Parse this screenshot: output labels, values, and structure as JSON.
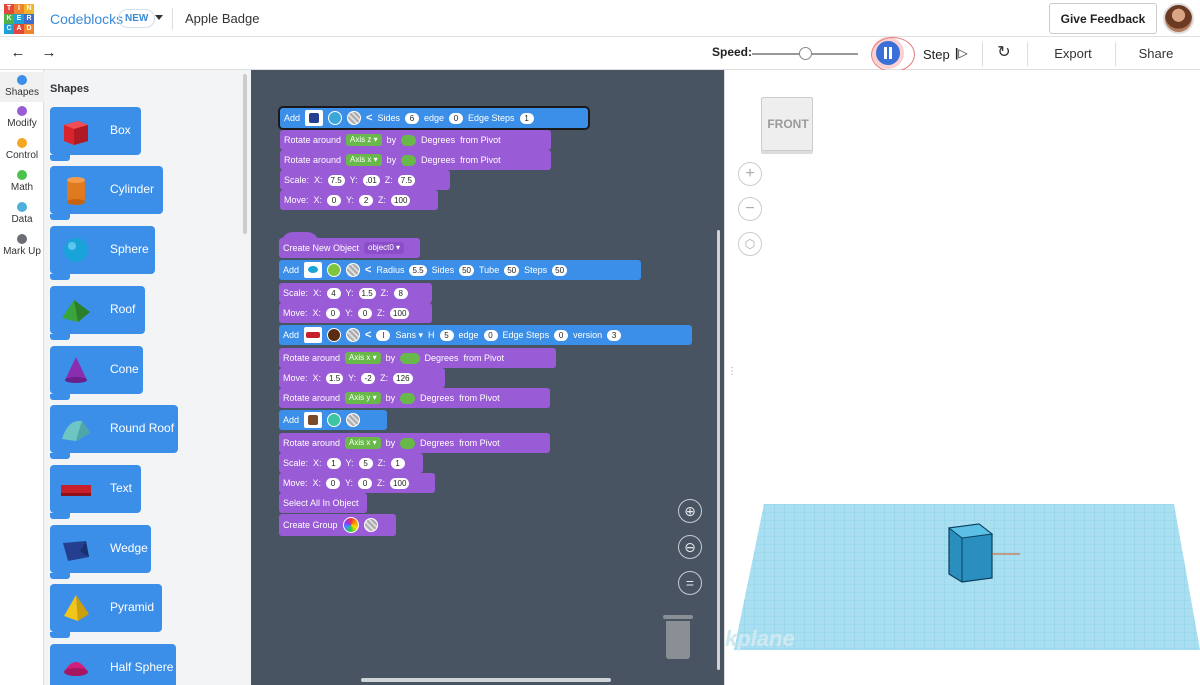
{
  "header": {
    "logo_letters": [
      "T",
      "I",
      "N",
      "K",
      "E",
      "R",
      "C",
      "A",
      "D"
    ],
    "app_name": "Codeblocks",
    "new_badge": "NEW",
    "project_name": "Apple Badge",
    "feedback_label": "Give Feedback"
  },
  "toolbar": {
    "speed_label": "Speed:",
    "speed_value": 0.5,
    "step_label": "Step",
    "export_label": "Export",
    "share_label": "Share"
  },
  "categories": [
    {
      "label": "Shapes",
      "color": "#3c8fe8"
    },
    {
      "label": "Modify",
      "color": "#9a5bd6"
    },
    {
      "label": "Control",
      "color": "#f5a623"
    },
    {
      "label": "Math",
      "color": "#4cc24c"
    },
    {
      "label": "Data",
      "color": "#4fb0d9"
    },
    {
      "label": "Mark Up",
      "color": "#6b6f75"
    }
  ],
  "flyout": {
    "title": "Shapes",
    "shapes": [
      {
        "label": "Box",
        "color": "#d9232f",
        "icon": "box-icon"
      },
      {
        "label": "Cylinder",
        "color": "#e07a1f",
        "icon": "cylinder-icon"
      },
      {
        "label": "Sphere",
        "color": "#1aa3d9",
        "icon": "sphere-icon"
      },
      {
        "label": "Roof",
        "color": "#3aa33a",
        "icon": "roof-icon"
      },
      {
        "label": "Cone",
        "color": "#8a2eb0",
        "icon": "cone-icon"
      },
      {
        "label": "Round Roof",
        "color": "#6fc4c4",
        "icon": "round-roof-icon"
      },
      {
        "label": "Text",
        "color": "#c8202a",
        "icon": "text-shape-icon"
      },
      {
        "label": "Wedge",
        "color": "#243f8f",
        "icon": "wedge-icon"
      },
      {
        "label": "Pyramid",
        "color": "#f2c51a",
        "icon": "pyramid-icon"
      },
      {
        "label": "Half Sphere",
        "color": "#d21d7a",
        "icon": "half-sphere-icon"
      }
    ]
  },
  "workspace": {
    "block1": {
      "add": "Add",
      "sides_label": "Sides",
      "sides": "6",
      "edge_label": "edge",
      "edge": "0",
      "steps_label": "Edge Steps",
      "steps": "1",
      "color": "#3aa7d8"
    },
    "rot1": {
      "label": "Rotate around",
      "axis": "Axis z ▾",
      "by": "by",
      "val": "90",
      "deg": "Degrees",
      "pivot": "from Pivot"
    },
    "rot2": {
      "label": "Rotate around",
      "axis": "Axis x ▾",
      "by": "by",
      "val": "90",
      "deg": "Degrees",
      "pivot": "from Pivot"
    },
    "scale1": {
      "label": "Scale:",
      "xl": "X:",
      "x": "7.5",
      "yl": "Y:",
      "y": ".01",
      "zl": "Z:",
      "z": "7.5"
    },
    "move1": {
      "label": "Move:",
      "xl": "X:",
      "x": "0",
      "yl": "Y:",
      "y": "2",
      "zl": "Z:",
      "z": "100"
    },
    "create": {
      "label": "Create New Object",
      "obj": "object0 ▾"
    },
    "block2": {
      "add": "Add",
      "radius_label": "Radius",
      "radius": "5.5",
      "sides_label": "Sides",
      "sides": "50",
      "tube_label": "Tube",
      "tube": "50",
      "steps_label": "Steps",
      "steps": "50",
      "color": "#7fc63f"
    },
    "scale2": {
      "label": "Scale:",
      "xl": "X:",
      "x": "4",
      "yl": "Y:",
      "y": "1.5",
      "zl": "Z:",
      "z": "8"
    },
    "move2": {
      "label": "Move:",
      "xl": "X:",
      "x": "0",
      "yl": "Y:",
      "y": "0",
      "zl": "Z:",
      "z": "100"
    },
    "block3": {
      "add": "Add",
      "text": "l",
      "font": "Sans ▾",
      "h_label": "H",
      "h": "5",
      "edge_label": "edge",
      "edge": "0",
      "steps_label": "Edge Steps",
      "steps": "0",
      "version_label": "version",
      "version": "3",
      "color": "#5a2d12"
    },
    "rot3": {
      "label": "Rotate around",
      "axis": "Axis x ▾",
      "by": "by",
      "val": "105",
      "deg": "Degrees",
      "pivot": "from Pivot"
    },
    "move3": {
      "label": "Move:",
      "xl": "X:",
      "x": "1.5",
      "yl": "Y:",
      "y": "-2",
      "zl": "Z:",
      "z": "126"
    },
    "rot4": {
      "label": "Rotate around",
      "axis": "Axis y ▾",
      "by": "by",
      "val": "15",
      "deg": "Degrees",
      "pivot": "from Pivot"
    },
    "block4": {
      "add": "Add",
      "color": "#3dc4a0"
    },
    "rot5": {
      "label": "Rotate around",
      "axis": "Axis x ▾",
      "by": "by",
      "val": "90",
      "deg": "Degrees",
      "pivot": "from Pivot"
    },
    "scale3": {
      "label": "Scale:",
      "xl": "X:",
      "x": "1",
      "yl": "Y:",
      "y": "5",
      "zl": "Z:",
      "z": "1"
    },
    "move4": {
      "label": "Move:",
      "xl": "X:",
      "x": "0",
      "yl": "Y:",
      "y": "0",
      "zl": "Z:",
      "z": "100"
    },
    "select_all": "Select All In Object",
    "create_group": "Create Group"
  },
  "viewport": {
    "viewcube_label": "FRONT",
    "workplane_label": "kplane"
  }
}
